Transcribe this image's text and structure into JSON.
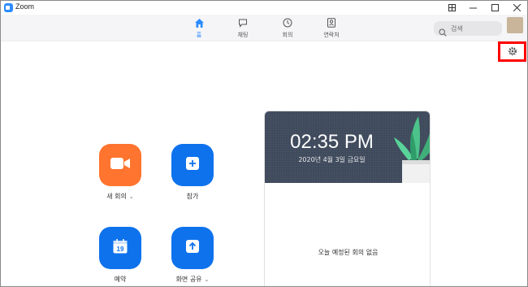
{
  "window": {
    "title": "Zoom"
  },
  "tabs": [
    {
      "id": "home",
      "label": "홈",
      "active": true
    },
    {
      "id": "chat",
      "label": "채팅",
      "active": false
    },
    {
      "id": "meetings",
      "label": "회의",
      "active": false
    },
    {
      "id": "contacts",
      "label": "연락처",
      "active": false
    }
  ],
  "search": {
    "placeholder": "검색"
  },
  "actions": {
    "new_meeting": {
      "label": "새 회의",
      "color": "#ff742e"
    },
    "join": {
      "label": "참가",
      "color": "#0e72ed"
    },
    "schedule": {
      "label": "예약",
      "color": "#0e72ed",
      "day": "19"
    },
    "share_screen": {
      "label": "화면 공유",
      "color": "#0e72ed"
    }
  },
  "calendar": {
    "time": "02:35 PM",
    "date": "2020년 4월 3일 금요일",
    "empty_message": "오늘 예정된 회의 없음"
  },
  "colors": {
    "accent": "#2d8cff",
    "highlight": "#ff0000"
  },
  "icons": [
    "zoom-logo-icon",
    "grid-icon",
    "minimize-icon",
    "maximize-icon",
    "close-icon",
    "home-icon",
    "chat-icon",
    "clock-icon",
    "contacts-icon",
    "search-icon",
    "gear-icon",
    "video-camera-icon",
    "plus-icon",
    "calendar-icon",
    "arrow-up-icon"
  ]
}
